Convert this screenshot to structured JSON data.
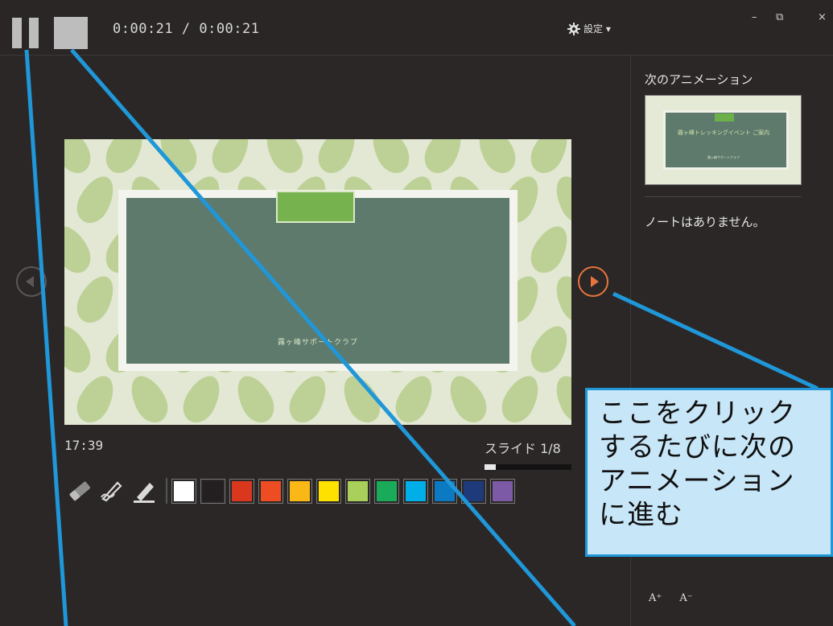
{
  "header": {
    "timer": "0:00:21 / 0:00:21",
    "settings_label": "設定 ▾",
    "window_controls": [
      "–",
      "⧉",
      "×"
    ]
  },
  "side_panel": {
    "next_animation_title": "次のアニメーション",
    "thumbnail_title": "霧ヶ峰トレッキングイベント ご案内",
    "thumbnail_subtitle": "霧ヶ峰サポートクラブ",
    "notes_text": "ノートはありません。",
    "font_buttons": [
      "A⁺",
      "A⁻"
    ]
  },
  "slide": {
    "caption": "霧ヶ峰サポートクラブ"
  },
  "footer": {
    "elapsed_time": "17:39",
    "slide_counter": "スライド 1/8",
    "progress_fraction": 0.125
  },
  "pen_tools": [
    "eraser-icon",
    "pen-icon",
    "highlighter-icon"
  ],
  "ink_colors": [
    "#ffffff",
    "#231f20",
    "#d9381e",
    "#ee4c23",
    "#f9b816",
    "#ffe100",
    "#a9d05b",
    "#1aab5a",
    "#00aee8",
    "#0b7ac2",
    "#1e3a7a",
    "#7c5aa6"
  ],
  "callout": {
    "lines": [
      "ここをクリック",
      "するたびに次の",
      "アニメーション",
      "に進む"
    ],
    "border_color": "#1f97d8",
    "fill_color": "#c7e6f7"
  }
}
